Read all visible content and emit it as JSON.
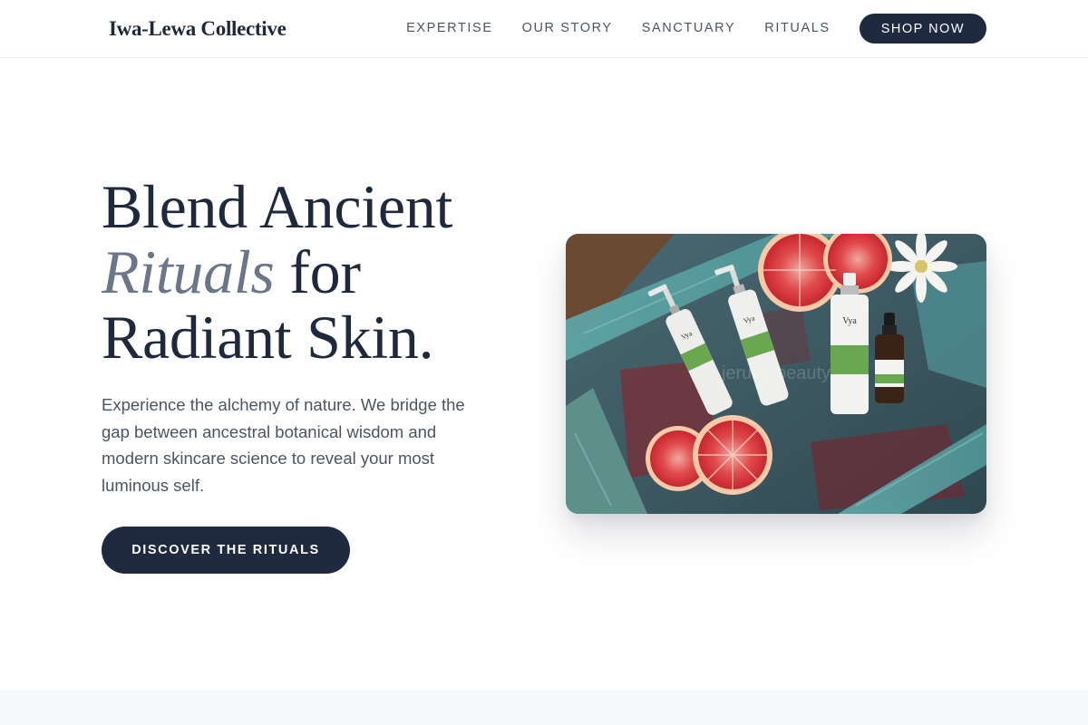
{
  "header": {
    "brand": "Iwa-Lewa Collective",
    "nav": [
      "EXPERTISE",
      "OUR STORY",
      "SANCTUARY",
      "RITUALS"
    ],
    "cta_label": "SHOP NOW"
  },
  "hero": {
    "title_line1": "Blend Ancient",
    "title_em": "Rituals",
    "title_line2_rest": "for",
    "title_line3": "Radiant Skin.",
    "description": "Experience the alchemy of nature. We bridge the gap between ancestral botanical wisdom and modern skincare science to reveal your most luminous self.",
    "cta_label": "DISCOVER THE RITUALS",
    "image": {
      "brand_label": "Vya Naturals",
      "watermark": "jeruca beauty",
      "product_labels": [
        "Vitamin C Face Wash",
        "Vitamin C Moisturizer",
        "Vitamin C Skin-Tightening Facial Mist",
        "Vitamin C Serum"
      ]
    }
  },
  "colors": {
    "navy": "#1f2a40",
    "text_dark": "#1e293b",
    "text_muted": "#4b5563",
    "accent_italic": "#6b7788",
    "label_green": "#6aa84f",
    "grapefruit": "#d9303a"
  }
}
